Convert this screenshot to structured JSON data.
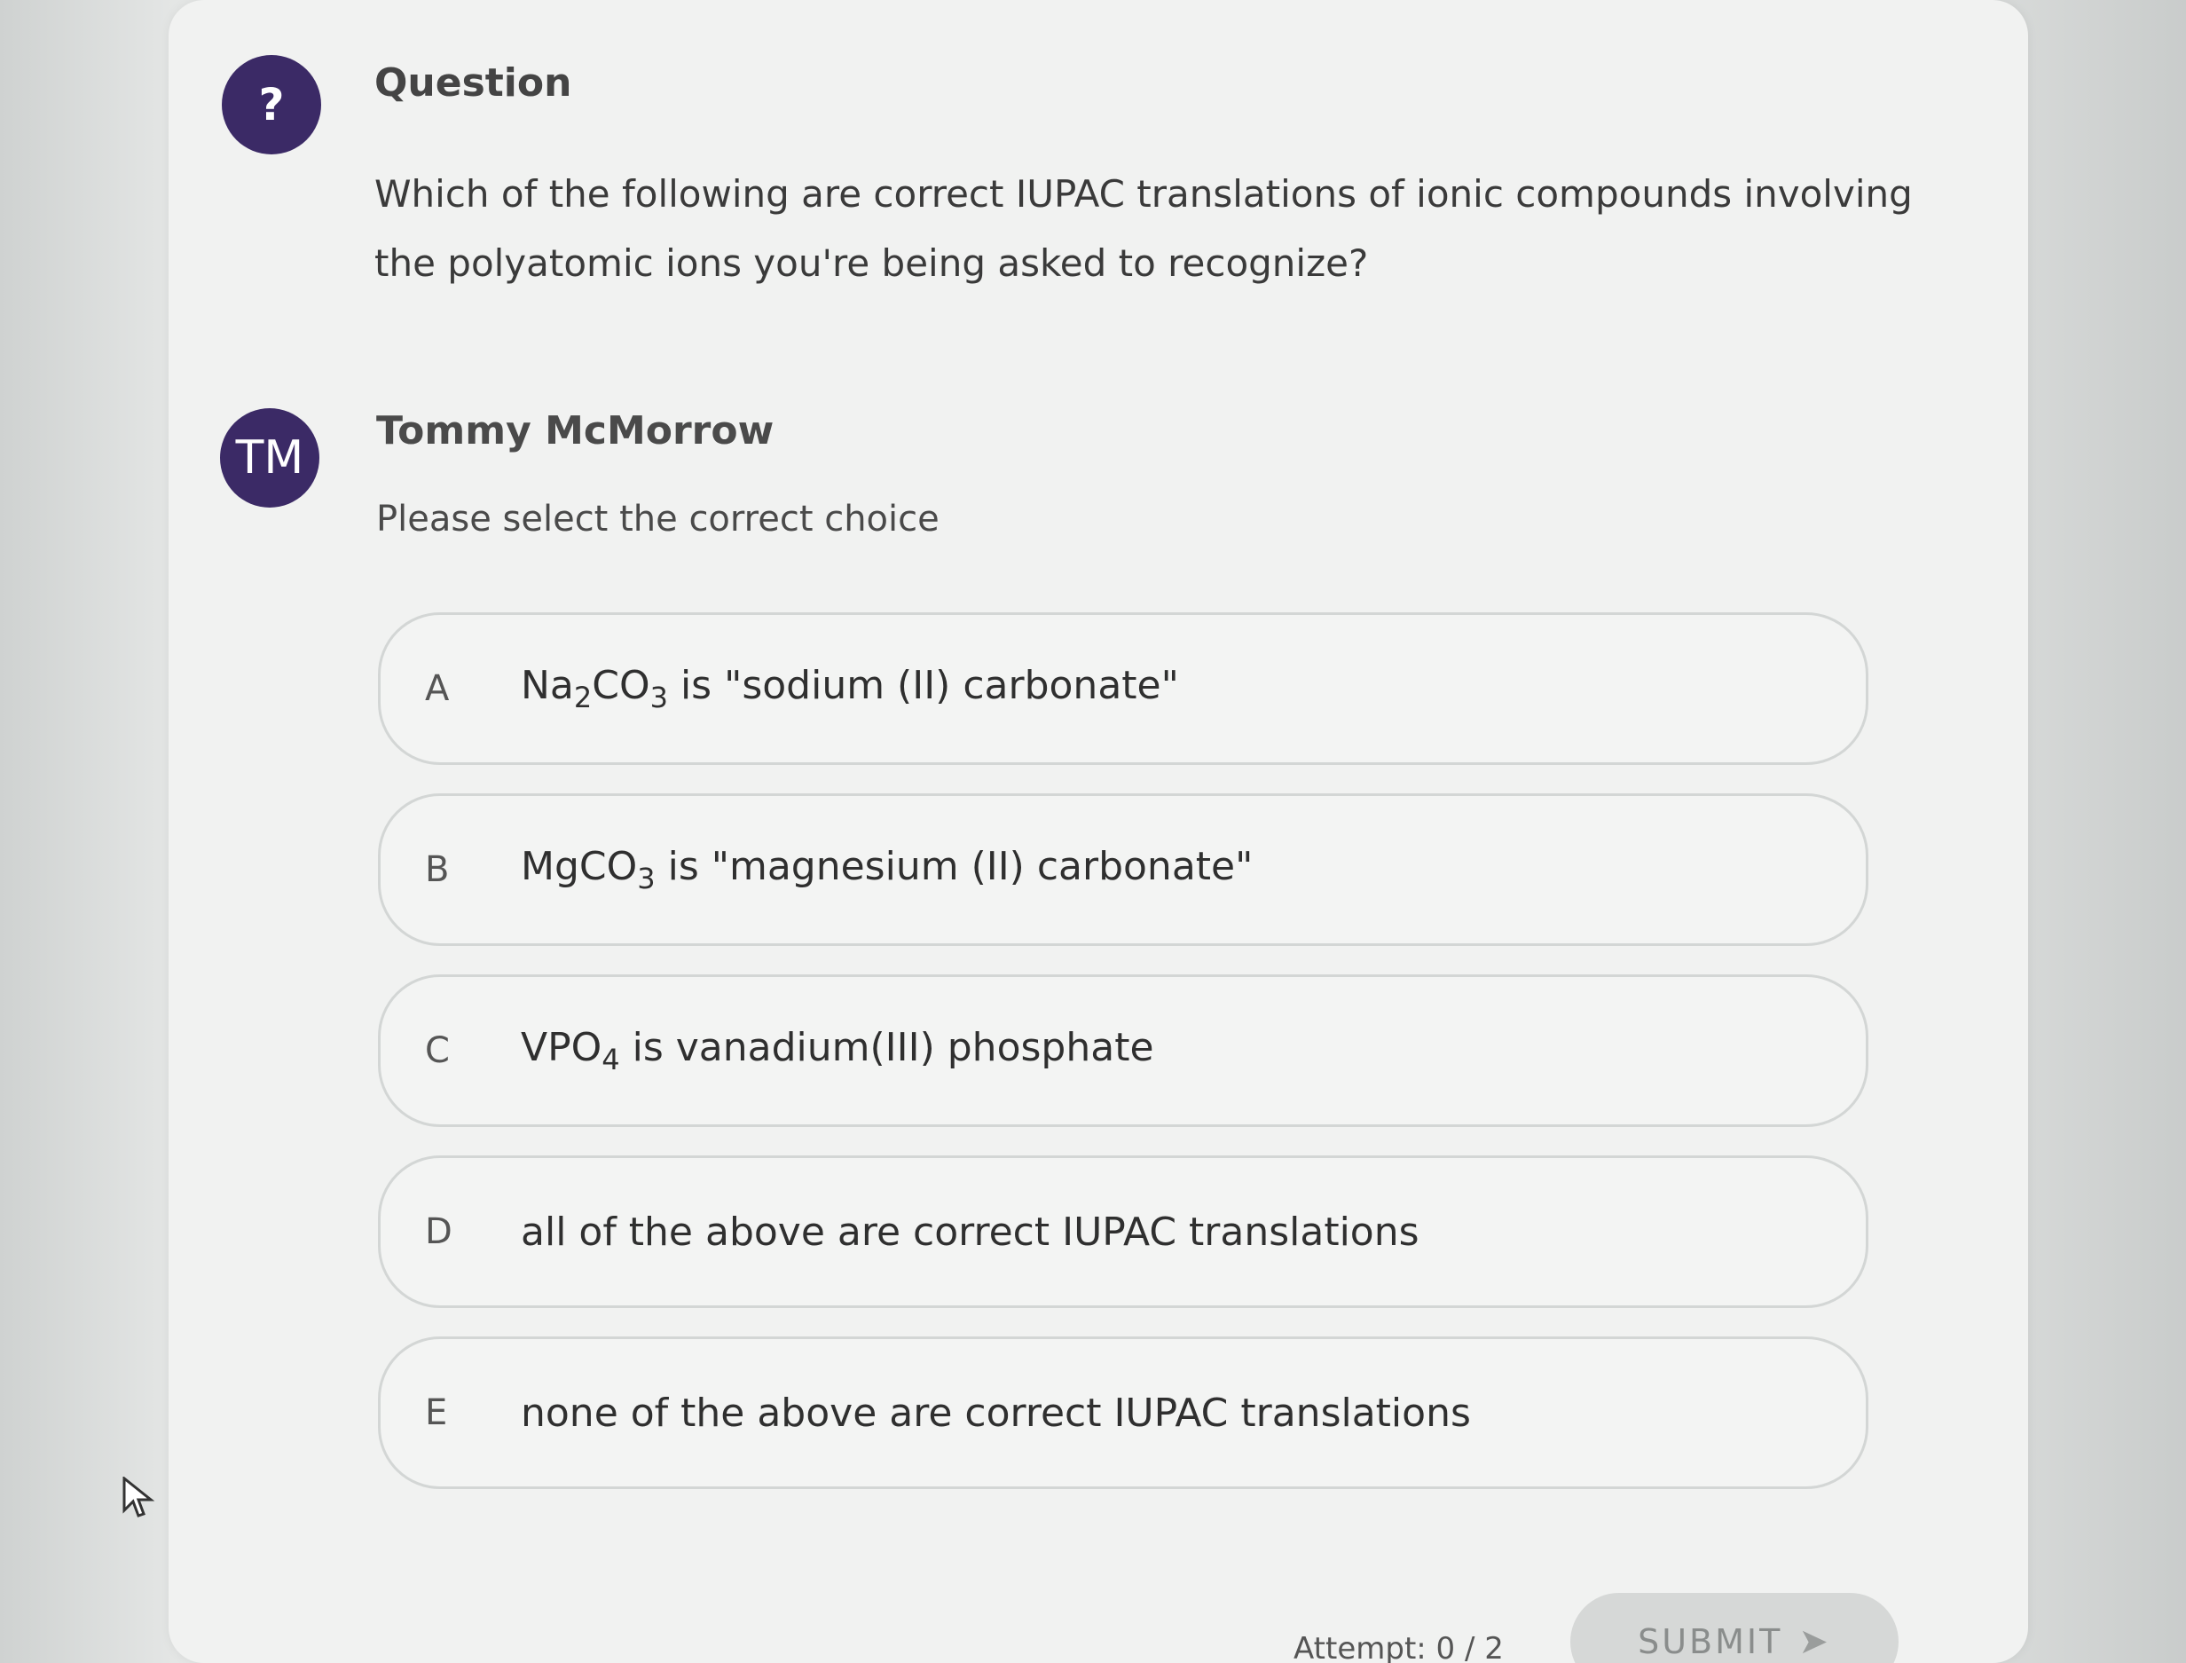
{
  "question": {
    "icon_label": "?",
    "title": "Question",
    "text": "Which of the following are correct IUPAC translations of ionic compounds involving the polyatomic ions you're being asked to recognize?"
  },
  "author": {
    "initials": "TM",
    "name": "Tommy McMorrow",
    "instruction": "Please select the correct choice"
  },
  "choices": [
    {
      "letter": "A",
      "formula_parts": [
        "Na",
        "2",
        "CO",
        "3"
      ],
      "suffix": " is \"sodium (II) carbonate\""
    },
    {
      "letter": "B",
      "formula_parts": [
        "MgCO",
        "3"
      ],
      "suffix": " is \"magnesium (II) carbonate\""
    },
    {
      "letter": "C",
      "formula_parts": [
        "VPO",
        "4"
      ],
      "suffix": " is vanadium(III) phosphate"
    },
    {
      "letter": "D",
      "text": "all of the above are correct IUPAC translations"
    },
    {
      "letter": "E",
      "text": "none of the above are correct IUPAC translations"
    }
  ],
  "footer": {
    "attempt": "Attempt: 0 / 2",
    "submit_label": "SUBMIT"
  },
  "colors": {
    "avatar": "#3b2a66",
    "choice_border": "#d3d6d5",
    "submit_bg": "#d6d8d7"
  },
  "icons": {
    "question": "question-mark-icon",
    "submit": "arrow-right-icon",
    "cursor": "mouse-pointer-icon"
  }
}
